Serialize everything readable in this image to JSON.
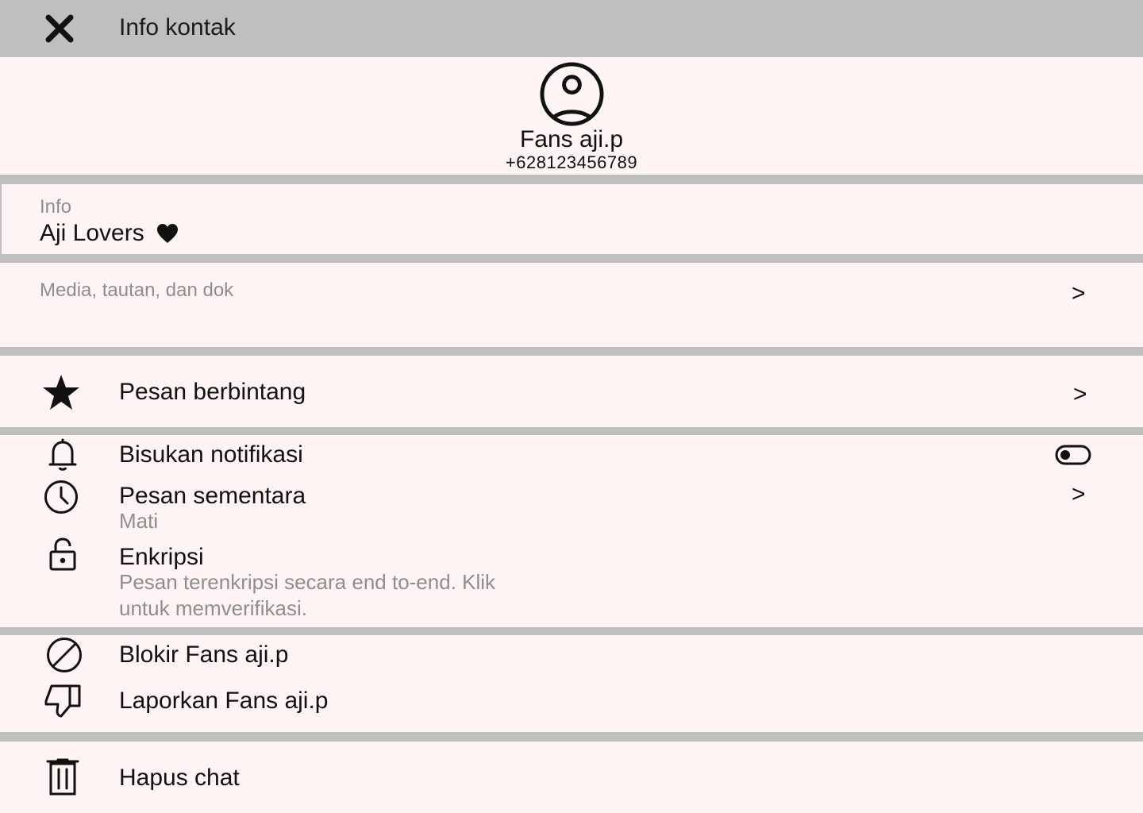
{
  "header": {
    "title": "Info kontak",
    "close_icon": "close-icon"
  },
  "profile": {
    "name": "Fans aji.p",
    "phone": "+628123456789",
    "avatar_icon": "user-circle-icon"
  },
  "about": {
    "label": "Info",
    "value": "Aji Lovers",
    "heart_icon": "heart-icon"
  },
  "media": {
    "label": "Media, tautan, dan dok",
    "chevron": ">"
  },
  "starred": {
    "label": "Pesan berbintang",
    "icon": "star-icon",
    "chevron": ">"
  },
  "settings": {
    "mute": {
      "label": "Bisukan notifikasi",
      "icon": "bell-icon",
      "toggle_on": false
    },
    "disappearing": {
      "label": "Pesan sementara",
      "value": "Mati",
      "icon": "clock-icon",
      "chevron": ">"
    },
    "encryption": {
      "label": "Enkripsi",
      "description_line1": "Pesan terenkripsi secara end to-end. Klik",
      "description_line2": "untuk memverifikasi.",
      "icon": "lock-icon"
    }
  },
  "danger": {
    "block": {
      "label": "Blokir Fans aji.p",
      "icon": "block-icon"
    },
    "report": {
      "label": "Laporkan Fans aji.p",
      "icon": "thumbs-down-icon"
    },
    "delete": {
      "label": "Hapus chat",
      "icon": "trash-icon"
    }
  },
  "colors": {
    "header_bg": "#c0bfc0",
    "panel_bg": "#fdf4f3",
    "danger": "#d10e10",
    "muted": "#8e8e8e"
  }
}
